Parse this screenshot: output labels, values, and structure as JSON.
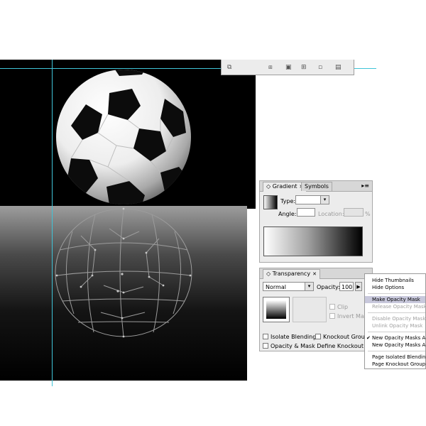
{
  "gradient_panel": {
    "tabs": [
      {
        "label": "Gradient",
        "active": true
      },
      {
        "label": "Symbols",
        "active": false
      }
    ],
    "type_label": "Type:",
    "type_value": "",
    "angle_label": "Angle:",
    "angle_value": "",
    "location_label": "Location:",
    "location_value": "",
    "percent": "%"
  },
  "transparency_panel": {
    "tab_label": "Transparency",
    "blend_mode": "Normal",
    "opacity_label": "Opacity:",
    "opacity_value": "100",
    "clip_label": "Clip",
    "invert_mask_label": "Invert Mask",
    "isolate_blending_label": "Isolate Blending",
    "knockout_group_label": "Knockout Group",
    "opacity_mask_label": "Opacity & Mask Define Knockout Shape"
  },
  "flyout_menu": {
    "items": [
      {
        "label": "Hide Thumbnails",
        "state": "normal"
      },
      {
        "label": "Hide Options",
        "state": "normal"
      },
      {
        "label": "Make Opacity Mask",
        "state": "selected"
      },
      {
        "label": "Release Opacity Mask",
        "state": "disabled"
      },
      {
        "label": "Disable Opacity Mask",
        "state": "disabled"
      },
      {
        "label": "Unlink Opacity Mask",
        "state": "disabled"
      },
      {
        "label": "New Opacity Masks Are Clipping",
        "state": "checked"
      },
      {
        "label": "New Opacity Masks Are Inverted",
        "state": "normal"
      },
      {
        "label": "Page Isolated Blending",
        "state": "normal"
      },
      {
        "label": "Page Knockout Group",
        "state": "normal"
      }
    ]
  },
  "colors": {
    "guide": "#3fc4d8",
    "artboard": "#000000",
    "panel_bg": "#ececec",
    "menu_highlight": "#c8c8dc"
  }
}
